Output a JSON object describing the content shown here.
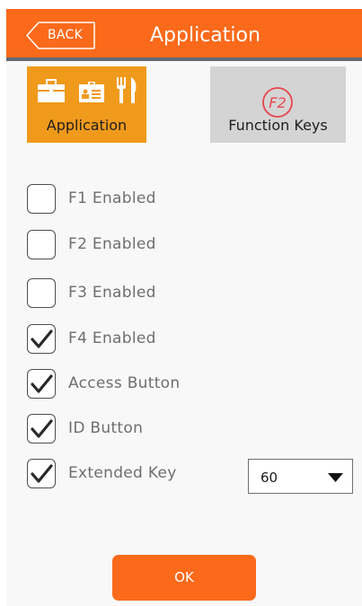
{
  "header": {
    "back_label": "BACK",
    "title": "Application"
  },
  "tabs": [
    {
      "label": "Application",
      "active": true,
      "icons": [
        "briefcase-icon",
        "id-card-icon",
        "utensils-icon"
      ]
    },
    {
      "label": "Function Keys",
      "active": false,
      "icon_text": "F2"
    }
  ],
  "options": [
    {
      "label": "F1 Enabled",
      "checked": false
    },
    {
      "label": "F2 Enabled",
      "checked": false
    },
    {
      "label": "F3 Enabled",
      "checked": false
    },
    {
      "label": "F4 Enabled",
      "checked": true
    },
    {
      "label": "Access Button",
      "checked": true
    },
    {
      "label": "ID Button",
      "checked": true
    },
    {
      "label": "Extended Key",
      "checked": true
    }
  ],
  "extended_key_select": {
    "value": "60"
  },
  "ok_label": "OK",
  "colors": {
    "header": "#fb6a1b",
    "active_tab": "#f09a1c",
    "inactive_tab": "#d4d4d4",
    "f2_circle": "#e8454f"
  }
}
